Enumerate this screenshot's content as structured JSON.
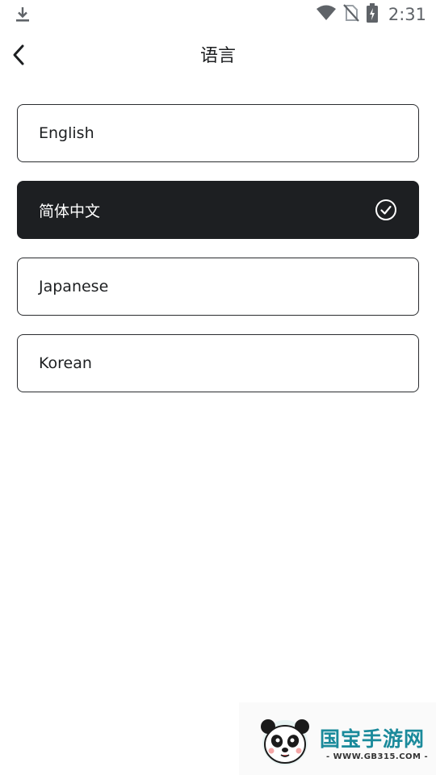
{
  "status_bar": {
    "time": "2:31",
    "icons": [
      "download-icon",
      "wifi-icon",
      "no-sim-icon",
      "battery-charging-icon"
    ]
  },
  "app_bar": {
    "title": "语言",
    "back_icon": "chevron-left-icon"
  },
  "languages": [
    {
      "label": "English",
      "selected": false
    },
    {
      "label": "简体中文",
      "selected": true
    },
    {
      "label": "Japanese",
      "selected": false
    },
    {
      "label": "Korean",
      "selected": false
    }
  ],
  "watermark": {
    "title": "国宝手游网",
    "url": "- WWW.GB315.COM -"
  },
  "colors": {
    "selected_bg": "#1d1f22",
    "text": "#1d1f21",
    "border": "#2a2c2f",
    "watermark_accent": "#1a8a9b"
  }
}
